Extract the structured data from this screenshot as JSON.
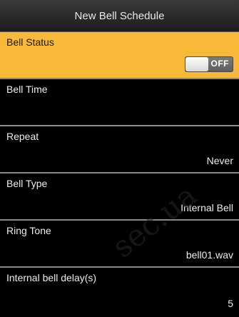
{
  "window": {
    "title": "New Bell Schedule"
  },
  "settings": [
    {
      "label": "Bell Status",
      "value": "OFF",
      "control": "toggle"
    },
    {
      "label": "Bell Time",
      "value": ""
    },
    {
      "label": "Repeat",
      "value": "Never"
    },
    {
      "label": "Bell Type",
      "value": "Internal Bell"
    },
    {
      "label": "Ring Tone",
      "value": "bell01.wav"
    },
    {
      "label": "Internal bell delay(s)",
      "value": "5"
    }
  ],
  "watermark": {
    "text": "sec.ua"
  },
  "colors": {
    "selected_row": "#f7b937",
    "background": "#000000",
    "divider": "#8a8a8a"
  }
}
